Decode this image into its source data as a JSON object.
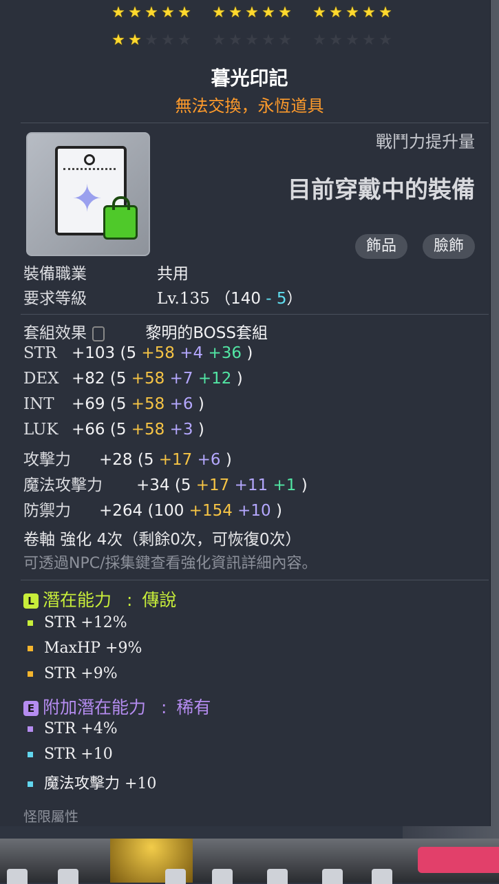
{
  "stars": {
    "row1": [
      [
        1,
        1,
        1,
        1,
        1
      ],
      [
        1,
        1,
        1,
        1,
        1
      ],
      [
        1,
        1,
        1,
        1,
        1
      ]
    ],
    "row2": [
      [
        1,
        1,
        0,
        0,
        0
      ],
      [
        0,
        0,
        0,
        0,
        0
      ],
      [
        0,
        0,
        0,
        0,
        0
      ]
    ]
  },
  "item": {
    "name": "暮光印記",
    "trade_note": "無法交換，永恆道具",
    "power_label": "戰鬥力提升量",
    "equipped_label": "目前穿戴中的裝備",
    "tags": [
      "飾品",
      "臉飾"
    ]
  },
  "requirements": {
    "job_label": "裝備職業",
    "job_value": "共用",
    "level_label": "要求等級",
    "level_value": "Lv.135",
    "level_base": "140",
    "level_minus": "- 5"
  },
  "set_effect": {
    "label": "套組效果",
    "value": "黎明的BOSS套組"
  },
  "stats": [
    {
      "name": "STR",
      "total": "+103",
      "base": "5",
      "parts": [
        {
          "v": "+58",
          "c": "yellow"
        },
        {
          "v": "+4",
          "c": "purple"
        },
        {
          "v": "+36",
          "c": "green"
        }
      ]
    },
    {
      "name": "DEX",
      "total": "+82",
      "base": "5",
      "parts": [
        {
          "v": "+58",
          "c": "yellow"
        },
        {
          "v": "+7",
          "c": "purple"
        },
        {
          "v": "+12",
          "c": "green"
        }
      ]
    },
    {
      "name": "INT",
      "total": "+69",
      "base": "5",
      "parts": [
        {
          "v": "+58",
          "c": "yellow"
        },
        {
          "v": "+6",
          "c": "purple"
        }
      ]
    },
    {
      "name": "LUK",
      "total": "+66",
      "base": "5",
      "parts": [
        {
          "v": "+58",
          "c": "yellow"
        },
        {
          "v": "+3",
          "c": "purple"
        }
      ]
    },
    {
      "name": "攻擊力",
      "total": "+28",
      "base": "5",
      "parts": [
        {
          "v": "+17",
          "c": "yellow"
        },
        {
          "v": "+6",
          "c": "purple"
        }
      ]
    },
    {
      "name": "魔法攻擊力",
      "total": "+34",
      "base": "5",
      "parts": [
        {
          "v": "+17",
          "c": "yellow"
        },
        {
          "v": "+11",
          "c": "purple"
        },
        {
          "v": "+1",
          "c": "green"
        }
      ]
    },
    {
      "name": "防禦力",
      "total": "+264",
      "base": "100",
      "parts": [
        {
          "v": "+154",
          "c": "yellow"
        },
        {
          "v": "+10",
          "c": "purple"
        }
      ]
    }
  ],
  "scroll": {
    "text": "卷軸 強化 4次（剩餘0次，可恢復0次）",
    "hint": "可透過NPC/採集鍵查看強化資訊詳細內容。"
  },
  "potential": {
    "badge": "L",
    "label": "潛在能力",
    "grade": "傳說",
    "lines": [
      {
        "text": "STR +12%",
        "color": "#c8ee3a"
      },
      {
        "text": "MaxHP +9%",
        "color": "#f5b52e"
      },
      {
        "text": "STR +9%",
        "color": "#f5b52e"
      }
    ]
  },
  "additional": {
    "badge": "E",
    "label": "附加潛在能力",
    "grade": "稀有",
    "lines": [
      {
        "text": "STR +4%",
        "color": "#b58cf0"
      },
      {
        "text": "STR +10",
        "color": "#62d6ee"
      },
      {
        "text": "魔法攻擊力 +10",
        "color": "#62d6ee"
      }
    ]
  },
  "cutoff_text": "怪限屬性"
}
